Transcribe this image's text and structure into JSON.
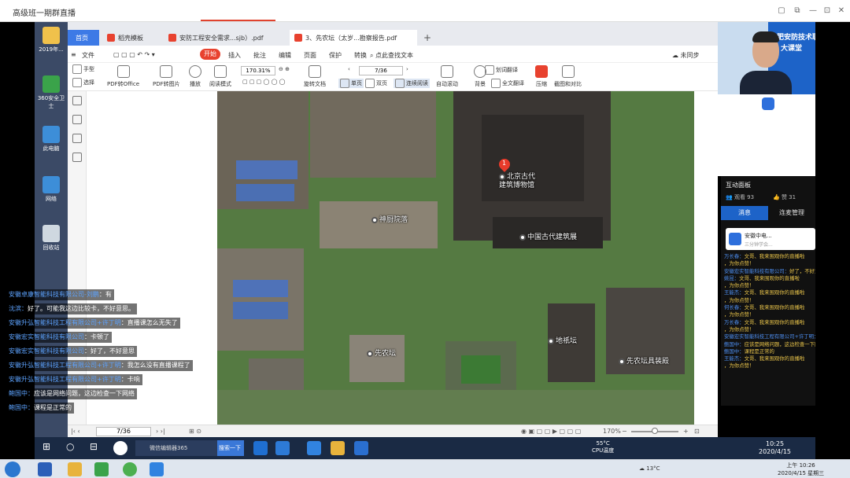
{
  "outer_window": {
    "title": "高级班一期群直播"
  },
  "desktop": {
    "icons": [
      {
        "label": "2019年...",
        "icon": "document-icon",
        "color": "#f0c14b"
      },
      {
        "label": "360安全卫士",
        "icon": "shield-icon",
        "color": "#3aa34a"
      },
      {
        "label": "此电脑",
        "icon": "computer-icon",
        "color": "#3d8ed8"
      },
      {
        "label": "网络",
        "icon": "network-icon",
        "color": "#3d8ed8"
      },
      {
        "label": "回收站",
        "icon": "recycle-bin-icon",
        "color": "#cfd8e0"
      }
    ]
  },
  "wps": {
    "tabs": [
      {
        "label": "首页",
        "active": true
      },
      {
        "label": "稻壳模板",
        "icon_color": "#e8422f"
      },
      {
        "label": "安防工程安全需求...sjb）.pdf",
        "icon_color": "#e8422f"
      },
      {
        "label": "3、先农坛（太岁...勘察报告.pdf",
        "icon_color": "#e8422f"
      }
    ],
    "menubar": {
      "file": "文件",
      "start": "开始",
      "items": [
        "插入",
        "批注",
        "编辑",
        "页面",
        "保护",
        "转换"
      ],
      "search": "点此查找文本",
      "sync": "未同步"
    },
    "ribbon": {
      "hand": "手型",
      "select": "选择",
      "pdf_to_office": "PDF转Office",
      "pdf_to_image": "PDF转图片",
      "play": "播放",
      "read_mode": "阅读模式",
      "zoom": "170.31%",
      "page": "7/36",
      "rotate": "旋转文档",
      "single": "单页",
      "double": "双页",
      "continuous": "连续阅读",
      "auto_scroll": "自动滚动",
      "background": "背景",
      "word_translate": "划词翻译",
      "full_translate": "全文翻译",
      "compress": "压缩",
      "screenshot": "截图和对比"
    },
    "map": {
      "pin_number": "1",
      "labels": {
        "museum": "北京古代\n建筑博物馆",
        "kitchen": "神厨院落",
        "exhibition": "中国古代建筑展",
        "xiannongtan": "先农坛",
        "dijitan": "地祇坛",
        "costume": "先农坛具装殿"
      }
    },
    "status": {
      "page": "7/36",
      "zoom": "170%"
    }
  },
  "webcam": {
    "banner_line1": "合肥安防技术职业培训",
    "banner_line2": "大课堂"
  },
  "interaction_panel": {
    "title": "互动面板",
    "viewers": "观看 93",
    "likes": "赞 31",
    "tab_messages": "消息",
    "tab_connection": "连麦管理",
    "card_title": "安徽中电...",
    "card_subtitle": "三分钟学会...",
    "messages": [
      {
        "who": "万长春：",
        "say": "文哥、我来围观你的直播啦"
      },
      {
        "who": "",
        "say": "，为你点赞！"
      },
      {
        "who": "安徽宏实智能科技有限公司：",
        "say": "好了，不好意"
      },
      {
        "who": "姚昆：",
        "say": "文哥、我来围观你的直播啦"
      },
      {
        "who": "",
        "say": "，为你点赞！"
      },
      {
        "who": "王能杰：",
        "say": "文哥、我来围观你的直播啦"
      },
      {
        "who": "",
        "say": "，为你点赞！"
      },
      {
        "who": "何长春：",
        "say": "文哥、我来围观你的直播啦"
      },
      {
        "who": "",
        "say": "，为你点赞！"
      },
      {
        "who": "万长春：",
        "say": "文哥、我来围观你的直播啦"
      },
      {
        "who": "",
        "say": "，为你点赞！"
      },
      {
        "who": "安徽宏实智能科技工程有限公司+许丁明：",
        "say": "怎么没有直播课程了"
      },
      {
        "who": "鲍国中：",
        "say": "应该是网络问题，这边检查一下网络"
      },
      {
        "who": "鲍国中：",
        "say": "课程是正常的"
      },
      {
        "who": "王能杰：",
        "say": "文哥、我来围观你的直播啦"
      },
      {
        "who": "",
        "say": "，为你点赞！"
      }
    ]
  },
  "danmaku": [
    {
      "who": "安徽卓康智能科技有限公司-刘鹏",
      "say": "：有"
    },
    {
      "who": "沈滨：",
      "say": "好了。可能我这边比较卡，不好意思。"
    },
    {
      "who": "安徽升弘智能科技工程有限公司+许丁明",
      "say": "：直播课怎么无失了"
    },
    {
      "who": "安徽宏实智能科技有限公司",
      "say": "：卡顿了"
    },
    {
      "who": "安徽宏实智能科技有限公司",
      "say": "：好了，不好意思"
    },
    {
      "who": "安徽升弘智能科技工程有限公司+许丁明",
      "say": "：我怎么没有直播课程了"
    },
    {
      "who": "安徽升弘智能科技工程有限公司+许丁明",
      "say": "：卡响"
    },
    {
      "who": "鲍国中：",
      "say": "应该是网络问题，这边检查一下网络"
    },
    {
      "who": "鲍国中：",
      "say": "课程是正常的"
    }
  ],
  "inner_taskbar": {
    "wechat": "微信编辑器365",
    "search": "搜索一下",
    "weather_temp": "55°C",
    "weather_label": "CPU温度",
    "time": "10:25",
    "date": "2020/4/15"
  },
  "outer_taskbar": {
    "weather": "13°C",
    "time": "上午 10:26",
    "date": "2020/4/15 星期三"
  }
}
